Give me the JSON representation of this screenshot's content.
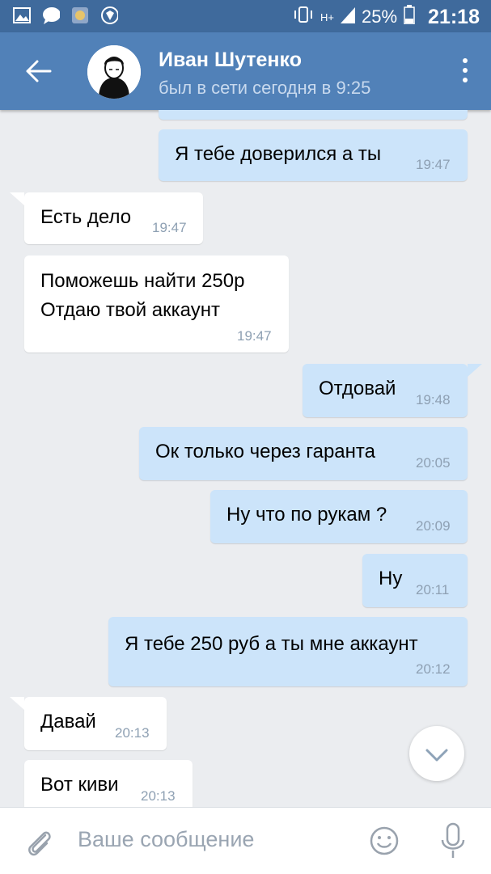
{
  "status_bar": {
    "network": "H+",
    "battery": "25%",
    "time": "21:18"
  },
  "header": {
    "contact_name": "Иван Шутенко",
    "last_seen": "был в сети сегодня в 9:25"
  },
  "messages": [
    {
      "direction": "out",
      "text": "Я тебе доверился а ты",
      "time": "19:47"
    },
    {
      "direction": "in",
      "text": "Есть дело",
      "time": "19:47"
    },
    {
      "direction": "in",
      "text_lines": [
        "Поможешь найти 250р",
        "Отдаю твой аккаунт"
      ],
      "time": "19:47"
    },
    {
      "direction": "out",
      "text": "Отдовай",
      "time": "19:48"
    },
    {
      "direction": "out",
      "text": "Ок только через гаранта",
      "time": "20:05"
    },
    {
      "direction": "out",
      "text": "Ну что по рукам ?",
      "time": "20:09"
    },
    {
      "direction": "out",
      "text": "Ну",
      "time": "20:11"
    },
    {
      "direction": "out",
      "text": "Я тебе 250 руб а ты мне аккаунт",
      "time": "20:12"
    },
    {
      "direction": "in",
      "text": "Давай",
      "time": "20:13"
    },
    {
      "direction": "in",
      "text": "Вот киви",
      "time": "20:13"
    }
  ],
  "composer": {
    "placeholder": "Ваше сообщение"
  },
  "colors": {
    "header": "#5181b8",
    "status_bar": "#3f6a9c",
    "outgoing_bubble": "#cce4fa",
    "incoming_bubble": "#ffffff",
    "background": "#ebedf0"
  }
}
